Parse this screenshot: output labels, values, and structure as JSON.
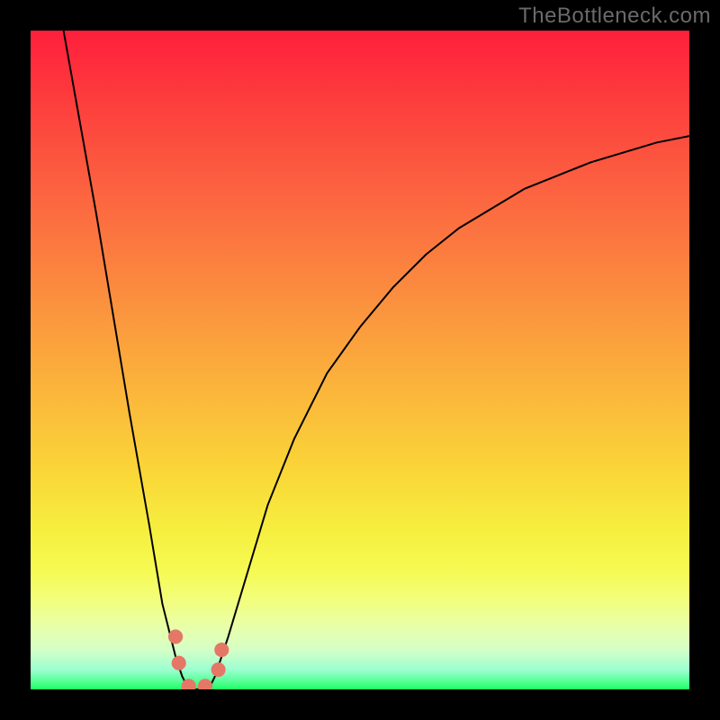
{
  "watermark": "TheBottleneck.com",
  "chart_data": {
    "type": "line",
    "title": "",
    "xlabel": "",
    "ylabel": "",
    "xlim": [
      0,
      100
    ],
    "ylim": [
      0,
      100
    ],
    "grid": false,
    "legend": false,
    "background_gradient": {
      "stops": [
        {
          "pos": 0,
          "color": "#FE1F3C"
        },
        {
          "pos": 50,
          "color": "#FBAE3C"
        },
        {
          "pos": 80,
          "color": "#F6FA53"
        },
        {
          "pos": 100,
          "color": "#1BFF64"
        }
      ]
    },
    "series": [
      {
        "name": "bottleneck-curve",
        "x": [
          5,
          10,
          15,
          18,
          20,
          22,
          23,
          24,
          25,
          26,
          27,
          28,
          30,
          33,
          36,
          40,
          45,
          50,
          55,
          60,
          65,
          70,
          75,
          80,
          85,
          90,
          95,
          100
        ],
        "y": [
          100,
          72,
          42,
          25,
          13,
          5,
          2,
          0,
          0,
          0,
          0,
          2,
          8,
          18,
          28,
          38,
          48,
          55,
          61,
          66,
          70,
          73,
          76,
          78,
          80,
          81.5,
          83,
          84
        ]
      }
    ],
    "markers": [
      {
        "name": "left-dip-top",
        "x": 22.0,
        "y": 8
      },
      {
        "name": "left-dip-mid",
        "x": 22.5,
        "y": 4
      },
      {
        "name": "dip-bottom-l",
        "x": 24.0,
        "y": 0.5
      },
      {
        "name": "dip-bottom-r",
        "x": 26.5,
        "y": 0.5
      },
      {
        "name": "right-dip-mid",
        "x": 28.5,
        "y": 3
      },
      {
        "name": "right-dip-top",
        "x": 29.0,
        "y": 6
      }
    ],
    "marker_color": "#E57766",
    "curve_color": "#000000"
  }
}
